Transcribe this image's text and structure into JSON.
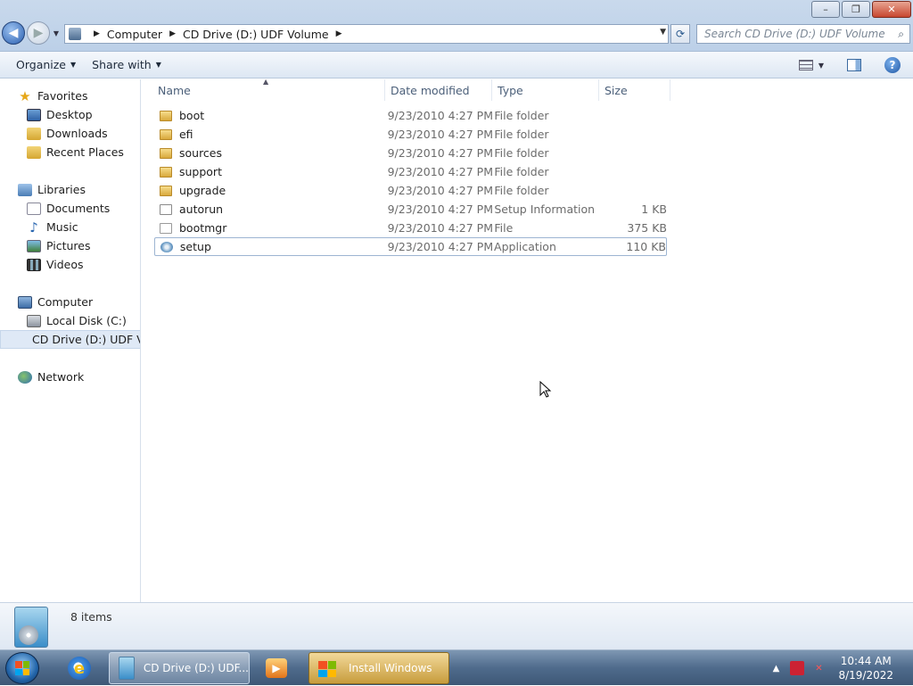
{
  "window": {
    "controls": {
      "minimize": "–",
      "maximize": "❐",
      "close": "✕"
    }
  },
  "address": {
    "crumbs": [
      "Computer",
      "CD Drive (D:) UDF Volume"
    ]
  },
  "search": {
    "placeholder": "Search CD Drive (D:) UDF Volume"
  },
  "toolbar": {
    "organize": "Organize",
    "share_with": "Share with"
  },
  "nav": {
    "favorites": {
      "label": "Favorites",
      "items": [
        "Desktop",
        "Downloads",
        "Recent Places"
      ]
    },
    "libraries": {
      "label": "Libraries",
      "items": [
        "Documents",
        "Music",
        "Pictures",
        "Videos"
      ]
    },
    "computer": {
      "label": "Computer",
      "items": [
        "Local Disk (C:)",
        "CD Drive (D:) UDF Volume"
      ]
    },
    "network": {
      "label": "Network"
    }
  },
  "columns": {
    "name": "Name",
    "date": "Date modified",
    "type": "Type",
    "size": "Size"
  },
  "files": [
    {
      "name": "boot",
      "date": "9/23/2010 4:27 PM",
      "type": "File folder",
      "size": "",
      "icon": "folder-icon"
    },
    {
      "name": "efi",
      "date": "9/23/2010 4:27 PM",
      "type": "File folder",
      "size": "",
      "icon": "folder-icon"
    },
    {
      "name": "sources",
      "date": "9/23/2010 4:27 PM",
      "type": "File folder",
      "size": "",
      "icon": "folder-icon"
    },
    {
      "name": "support",
      "date": "9/23/2010 4:27 PM",
      "type": "File folder",
      "size": "",
      "icon": "folder-icon"
    },
    {
      "name": "upgrade",
      "date": "9/23/2010 4:27 PM",
      "type": "File folder",
      "size": "",
      "icon": "folder-icon"
    },
    {
      "name": "autorun",
      "date": "9/23/2010 4:27 PM",
      "type": "Setup Information",
      "size": "1 KB",
      "icon": "settings-file-icon"
    },
    {
      "name": "bootmgr",
      "date": "9/23/2010 4:27 PM",
      "type": "File",
      "size": "375 KB",
      "icon": "file-icon"
    },
    {
      "name": "setup",
      "date": "9/23/2010 4:27 PM",
      "type": "Application",
      "size": "110 KB",
      "icon": "setup-icon"
    }
  ],
  "status": {
    "item_count": "8 items"
  },
  "taskbar": {
    "explorer_task": "CD Drive (D:) UDF...",
    "install_task": "Install Windows",
    "time": "10:44 AM",
    "date": "8/19/2022"
  },
  "colors": {
    "accent": "#3b8ec9",
    "selection_border": "#9db5d2",
    "install_task": "#c79c3c"
  }
}
